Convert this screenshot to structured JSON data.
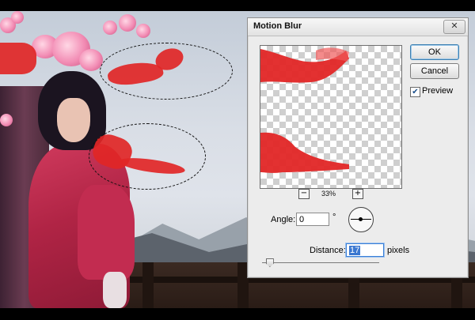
{
  "dialog": {
    "title": "Motion Blur",
    "close_glyph": "✕",
    "ok_label": "OK",
    "cancel_label": "Cancel",
    "preview_label": "Preview",
    "preview_checked": true,
    "check_glyph": "✔",
    "zoom_out_glyph": "−",
    "zoom_in_glyph": "+",
    "zoom_level": "33%",
    "angle_label": "Angle:",
    "angle_value": "0",
    "angle_unit": "°",
    "distance_label": "Distance:",
    "distance_value": "17",
    "distance_unit": "pixels",
    "distance_slider_level": 0.06
  },
  "colors": {
    "ribbon_red": "#e12626",
    "robe_red": "#b02445",
    "focus_blue": "#3a77d0"
  },
  "icons": {
    "close": "close-icon",
    "zoom_out": "minus-icon",
    "zoom_in": "plus-icon",
    "angle_dial": "angle-dial-icon",
    "checkbox": "checkmark-icon"
  }
}
